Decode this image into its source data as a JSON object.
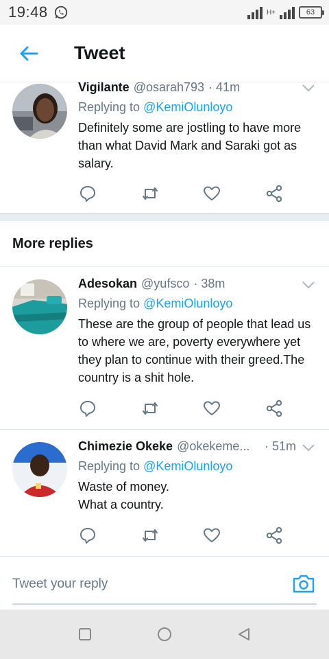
{
  "status_bar": {
    "time": "19:48",
    "network": "H+",
    "battery": "63"
  },
  "header": {
    "title": "Tweet"
  },
  "section": {
    "more_replies": "More replies"
  },
  "tweets": [
    {
      "name": "Vigilante",
      "handle": "@osarah793",
      "time": "· 41m",
      "replying_label": "Replying to",
      "replying_to": "@KemiOlunloyo",
      "text": "Definitely some are jostling to have more than what David Mark and Saraki got as salary."
    },
    {
      "name": "Adesokan",
      "handle": "@yufsco",
      "time": "· 38m",
      "replying_label": "Replying to",
      "replying_to": "@KemiOlunloyo",
      "text": "These are the group of people that lead us to where we are,  poverty everywhere yet they plan to continue with their greed.The country is a shit hole."
    },
    {
      "name": "Chimezie Okeke",
      "handle": "@okekeme...",
      "time": "· 51m",
      "replying_label": "Replying to",
      "replying_to": "@KemiOlunloyo",
      "text_lines": [
        "Waste of money.",
        "What a country."
      ]
    }
  ],
  "compose": {
    "placeholder": "Tweet your reply"
  },
  "colors": {
    "accent": "#1da1f2",
    "secondary_text": "#657786",
    "separator": "#e6ecf0"
  },
  "icons": [
    "whatsapp-icon",
    "back-arrow-icon",
    "chevron-down-icon",
    "reply-icon",
    "retweet-icon",
    "like-icon",
    "share-icon",
    "camera-icon",
    "square-icon",
    "circle-icon",
    "triangle-back-icon"
  ]
}
